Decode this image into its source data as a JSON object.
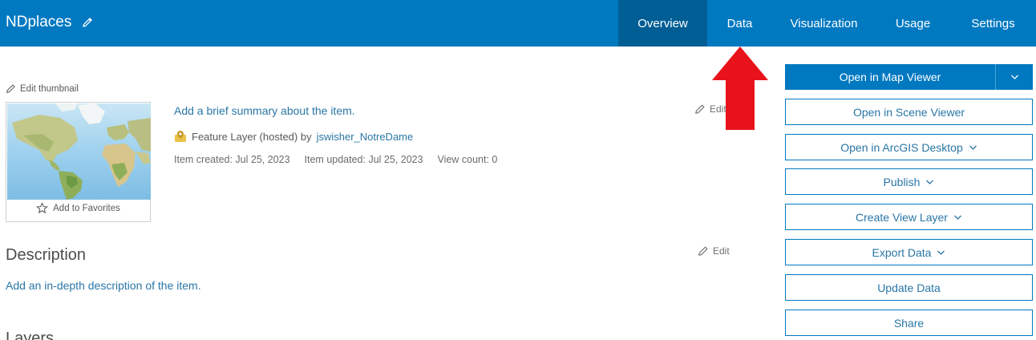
{
  "header": {
    "title": "NDplaces",
    "tabs": [
      {
        "label": "Overview",
        "active": true
      },
      {
        "label": "Data",
        "active": false
      },
      {
        "label": "Visualization",
        "active": false
      },
      {
        "label": "Usage",
        "active": false
      },
      {
        "label": "Settings",
        "active": false
      }
    ]
  },
  "thumbnail": {
    "edit_label": "Edit thumbnail",
    "favorites_label": "Add to Favorites"
  },
  "item": {
    "summary_prompt": "Add a brief summary about the item.",
    "type_text": "Feature Layer (hosted) by",
    "owner": "jswisher_NotreDame",
    "created": "Item created: Jul 25, 2023",
    "updated": "Item updated: Jul 25, 2023",
    "views": "View count: 0",
    "edit_label": "Edit"
  },
  "description": {
    "heading": "Description",
    "prompt": "Add an in-depth description of the item.",
    "edit_label": "Edit"
  },
  "layers": {
    "heading": "Layers"
  },
  "actions": {
    "open_map_viewer": "Open in Map Viewer",
    "open_scene_viewer": "Open in Scene Viewer",
    "open_arcgis_desktop": "Open in ArcGIS Desktop",
    "publish": "Publish",
    "create_view_layer": "Create View Layer",
    "export_data": "Export Data",
    "update_data": "Update Data",
    "share": "Share"
  },
  "colors": {
    "header": "#0079c1",
    "active_tab": "#005e95",
    "link": "#2a76a6",
    "annotation_arrow": "#e8121b"
  }
}
